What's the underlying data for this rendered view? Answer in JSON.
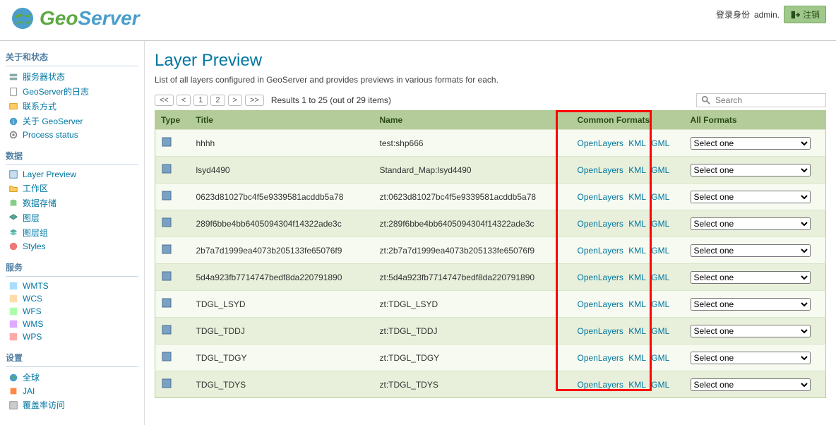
{
  "header": {
    "logo_geo": "Geo",
    "logo_server": "Server",
    "login_label": "登录身份",
    "username": "admin.",
    "logout_label": "注销"
  },
  "sidebar": {
    "groups": [
      {
        "title": "关于和状态",
        "items": [
          {
            "label": "服务器状态",
            "icon": "server-icon"
          },
          {
            "label": "GeoServer的日志",
            "icon": "file-icon"
          },
          {
            "label": "联系方式",
            "icon": "contact-icon"
          },
          {
            "label": "关于 GeoServer",
            "icon": "info-icon"
          },
          {
            "label": "Process status",
            "icon": "gear-icon"
          }
        ]
      },
      {
        "title": "数据",
        "items": [
          {
            "label": "Layer Preview",
            "icon": "preview-icon"
          },
          {
            "label": "工作区",
            "icon": "folder-icon"
          },
          {
            "label": "数据存储",
            "icon": "db-icon"
          },
          {
            "label": "图层",
            "icon": "layer-icon"
          },
          {
            "label": "图层组",
            "icon": "layergroup-icon"
          },
          {
            "label": "Styles",
            "icon": "style-icon"
          }
        ]
      },
      {
        "title": "服务",
        "items": [
          {
            "label": "WMTS",
            "icon": "wmts-icon"
          },
          {
            "label": "WCS",
            "icon": "wcs-icon"
          },
          {
            "label": "WFS",
            "icon": "wfs-icon"
          },
          {
            "label": "WMS",
            "icon": "wms-icon"
          },
          {
            "label": "WPS",
            "icon": "wps-icon"
          }
        ]
      },
      {
        "title": "设置",
        "items": [
          {
            "label": "全球",
            "icon": "globe-icon"
          },
          {
            "label": "JAI",
            "icon": "jai-icon"
          },
          {
            "label": "覆盖率访问",
            "icon": "coverage-icon"
          }
        ]
      }
    ]
  },
  "main": {
    "title": "Layer Preview",
    "desc": "List of all layers configured in GeoServer and provides previews in various formats for each.",
    "pager": {
      "first": "<<",
      "prev": "<",
      "p1": "1",
      "p2": "2",
      "next": ">",
      "last": ">>",
      "info": "Results 1 to 25 (out of 29 items)"
    },
    "search": {
      "placeholder": "Search"
    },
    "columns": {
      "type": "Type",
      "title": "Title",
      "name": "Name",
      "common": "Common Formats",
      "all": "All Formats"
    },
    "common_fmt": {
      "ol": "OpenLayers",
      "kml": "KML",
      "gml": "GML"
    },
    "select_default": "Select one",
    "rows": [
      {
        "title": "hhhh",
        "name": "test:shp666",
        "type": "polygon"
      },
      {
        "title": "lsyd4490",
        "name": "Standard_Map:lsyd4490",
        "type": "polygon"
      },
      {
        "title": "0623d81027bc4f5e9339581acddb5a78",
        "name": "zt:0623d81027bc4f5e9339581acddb5a78",
        "type": "polygon"
      },
      {
        "title": "289f6bbe4bb6405094304f14322ade3c",
        "name": "zt:289f6bbe4bb6405094304f14322ade3c",
        "type": "polygon"
      },
      {
        "title": "2b7a7d1999ea4073b205133fe65076f9",
        "name": "zt:2b7a7d1999ea4073b205133fe65076f9",
        "type": "polygon"
      },
      {
        "title": "5d4a923fb7714747bedf8da220791890",
        "name": "zt:5d4a923fb7714747bedf8da220791890",
        "type": "polygon"
      },
      {
        "title": "TDGL_LSYD",
        "name": "zt:TDGL_LSYD",
        "type": "polygon"
      },
      {
        "title": "TDGL_TDDJ",
        "name": "zt:TDGL_TDDJ",
        "type": "polygon"
      },
      {
        "title": "TDGL_TDGY",
        "name": "zt:TDGL_TDGY",
        "type": "polygon"
      },
      {
        "title": "TDGL_TDYS",
        "name": "zt:TDGL_TDYS",
        "type": "polygon"
      }
    ]
  }
}
